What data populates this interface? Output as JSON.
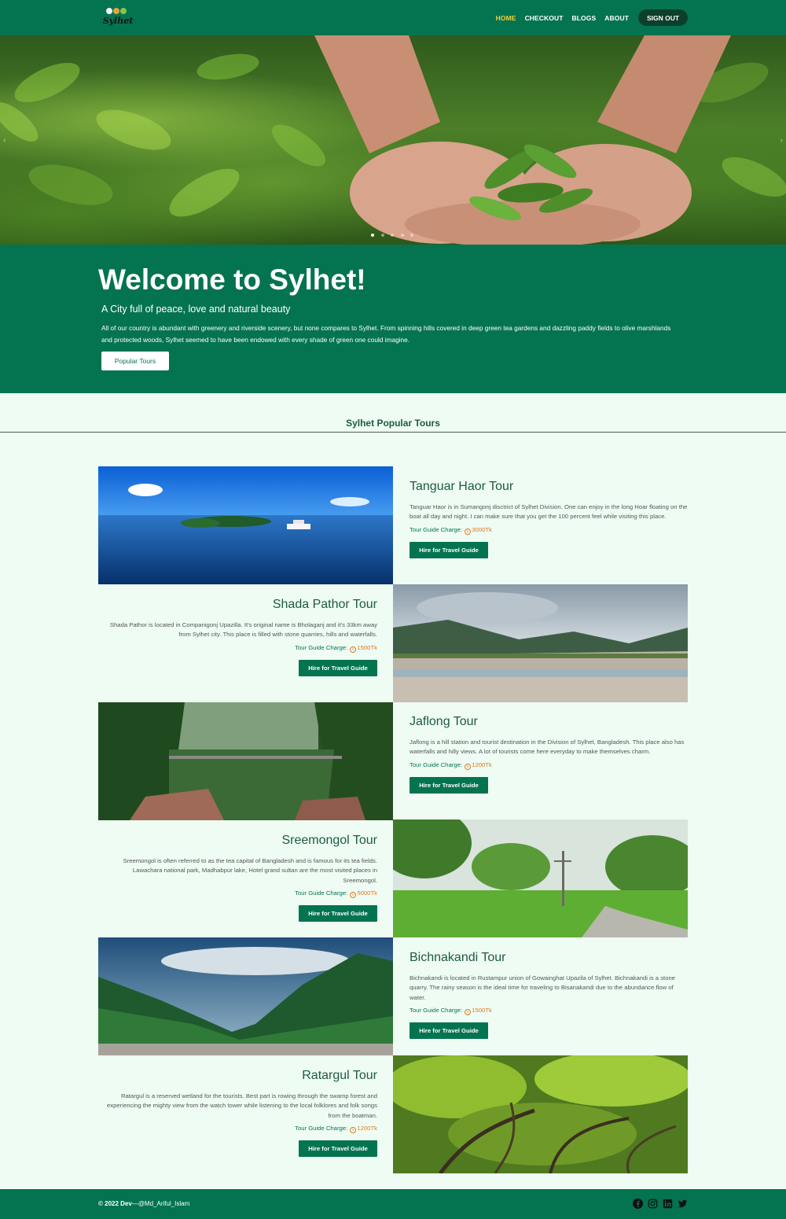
{
  "nav": {
    "logo_text": "Sylhet",
    "links": [
      "HOME",
      "CHECKOUT",
      "BLOGS",
      "ABOUT"
    ],
    "signout": "SIGN OUT"
  },
  "hero": {
    "prev_arrow": "‹",
    "next_arrow": "›",
    "slides": 5,
    "active_slide": 1
  },
  "welcome": {
    "title": "Welcome to Sylhet!",
    "subtitle": "A City full of peace, love and natural beauty",
    "text": "All of our country is abundant with greenery and riverside scenery, but none compares to Sylhet. From spinning hills covered in deep green tea gardens and dazzling paddy fields to olive marshlands and protected woods, Sylhet seemed to have been endowed with every shade of green one could imagine.",
    "button": "Popular Tours"
  },
  "section": {
    "title": "Sylhet Popular Tours"
  },
  "charge_label": "Tour Guide Charge:",
  "hire_label": "Hire for Travel Guide",
  "tours": [
    {
      "title": "Tanguar Haor Tour",
      "desc": "Tanguar Haor is in Sumangonj disctrict of Sylhet Division. One can enjoy in the long Hoar floating on the boat all day and night. I can make sure that you get the 100 percent feel while visiting this place.",
      "price": "3000Tk"
    },
    {
      "title": "Shada Pathor Tour",
      "desc": "Shada Pathor is located in Companigonj Upazilla. It's original name is Bholaganj and it's 33km away from Sylhet city. This place is filled with stone quarries, hills and waterfalls.",
      "price": "1500Tk"
    },
    {
      "title": "Jaflong Tour",
      "desc": "Jaflong is a hill station and tourist destination in the Division of Sylhet, Bangladesh. This place also has waterfalls and hilly views. A lot of tourists come here everyday to make themselves charm.",
      "price": "1200Tk"
    },
    {
      "title": "Sreemongol Tour",
      "desc": "Sreemongol is often referred to as the tea capital of Bangladesh and is famous for its tea fields. Lawachara national park, Madhabpur lake, Hotel grand sultan are the most visited places in Sreemongol.",
      "price": "5000Tk"
    },
    {
      "title": "Bichnakandi Tour",
      "desc": "Bichnakandi is located in Rustampur union of Gowainghat Upazila of Sylhet. Bichnakandi is a stone quarry. The rainy season is the ideal time for traveling to Bisanakandi due to the abundance flow of water.",
      "price": "1500Tk"
    },
    {
      "title": "Ratargul Tour",
      "desc": "Ratargul is a reserved wetland for the tourists. Best part is rowing through the swamp forest and experiencing the mighty view from the watch tower while listening to the local folklores and folk songs from the boatman.",
      "price": "1200Tk"
    }
  ],
  "footer": {
    "copyright": "© 2022 Dev",
    "author": "—@Md_Ariful_Islam",
    "socials": [
      "facebook-icon",
      "instagram-icon",
      "linkedin-icon",
      "twitter-icon"
    ]
  },
  "colors": {
    "brand": "#047450",
    "accent": "#f2d03b",
    "price": "#e07a1f",
    "background": "#eefcf4"
  }
}
